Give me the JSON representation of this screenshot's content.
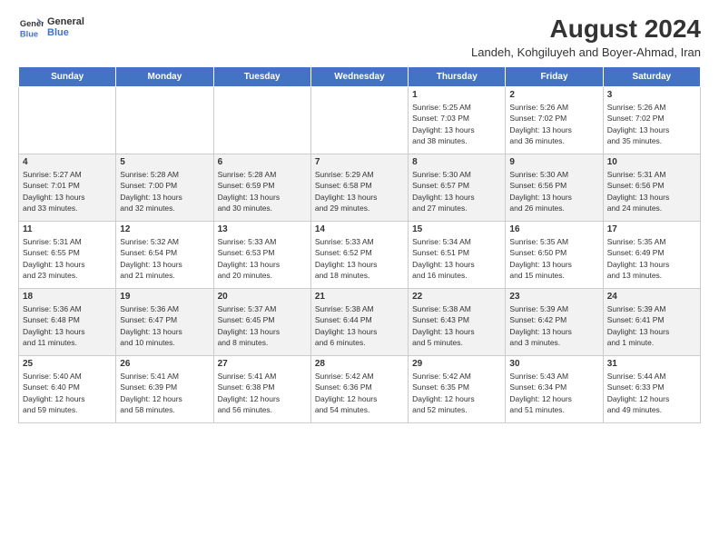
{
  "logo": {
    "line1": "General",
    "line2": "Blue"
  },
  "title": "August 2024",
  "subtitle": "Landeh, Kohgiluyeh and Boyer-Ahmad, Iran",
  "weekdays": [
    "Sunday",
    "Monday",
    "Tuesday",
    "Wednesday",
    "Thursday",
    "Friday",
    "Saturday"
  ],
  "weeks": [
    [
      {
        "day": "",
        "info": ""
      },
      {
        "day": "",
        "info": ""
      },
      {
        "day": "",
        "info": ""
      },
      {
        "day": "",
        "info": ""
      },
      {
        "day": "1",
        "info": "Sunrise: 5:25 AM\nSunset: 7:03 PM\nDaylight: 13 hours\nand 38 minutes."
      },
      {
        "day": "2",
        "info": "Sunrise: 5:26 AM\nSunset: 7:02 PM\nDaylight: 13 hours\nand 36 minutes."
      },
      {
        "day": "3",
        "info": "Sunrise: 5:26 AM\nSunset: 7:02 PM\nDaylight: 13 hours\nand 35 minutes."
      }
    ],
    [
      {
        "day": "4",
        "info": "Sunrise: 5:27 AM\nSunset: 7:01 PM\nDaylight: 13 hours\nand 33 minutes."
      },
      {
        "day": "5",
        "info": "Sunrise: 5:28 AM\nSunset: 7:00 PM\nDaylight: 13 hours\nand 32 minutes."
      },
      {
        "day": "6",
        "info": "Sunrise: 5:28 AM\nSunset: 6:59 PM\nDaylight: 13 hours\nand 30 minutes."
      },
      {
        "day": "7",
        "info": "Sunrise: 5:29 AM\nSunset: 6:58 PM\nDaylight: 13 hours\nand 29 minutes."
      },
      {
        "day": "8",
        "info": "Sunrise: 5:30 AM\nSunset: 6:57 PM\nDaylight: 13 hours\nand 27 minutes."
      },
      {
        "day": "9",
        "info": "Sunrise: 5:30 AM\nSunset: 6:56 PM\nDaylight: 13 hours\nand 26 minutes."
      },
      {
        "day": "10",
        "info": "Sunrise: 5:31 AM\nSunset: 6:56 PM\nDaylight: 13 hours\nand 24 minutes."
      }
    ],
    [
      {
        "day": "11",
        "info": "Sunrise: 5:31 AM\nSunset: 6:55 PM\nDaylight: 13 hours\nand 23 minutes."
      },
      {
        "day": "12",
        "info": "Sunrise: 5:32 AM\nSunset: 6:54 PM\nDaylight: 13 hours\nand 21 minutes."
      },
      {
        "day": "13",
        "info": "Sunrise: 5:33 AM\nSunset: 6:53 PM\nDaylight: 13 hours\nand 20 minutes."
      },
      {
        "day": "14",
        "info": "Sunrise: 5:33 AM\nSunset: 6:52 PM\nDaylight: 13 hours\nand 18 minutes."
      },
      {
        "day": "15",
        "info": "Sunrise: 5:34 AM\nSunset: 6:51 PM\nDaylight: 13 hours\nand 16 minutes."
      },
      {
        "day": "16",
        "info": "Sunrise: 5:35 AM\nSunset: 6:50 PM\nDaylight: 13 hours\nand 15 minutes."
      },
      {
        "day": "17",
        "info": "Sunrise: 5:35 AM\nSunset: 6:49 PM\nDaylight: 13 hours\nand 13 minutes."
      }
    ],
    [
      {
        "day": "18",
        "info": "Sunrise: 5:36 AM\nSunset: 6:48 PM\nDaylight: 13 hours\nand 11 minutes."
      },
      {
        "day": "19",
        "info": "Sunrise: 5:36 AM\nSunset: 6:47 PM\nDaylight: 13 hours\nand 10 minutes."
      },
      {
        "day": "20",
        "info": "Sunrise: 5:37 AM\nSunset: 6:45 PM\nDaylight: 13 hours\nand 8 minutes."
      },
      {
        "day": "21",
        "info": "Sunrise: 5:38 AM\nSunset: 6:44 PM\nDaylight: 13 hours\nand 6 minutes."
      },
      {
        "day": "22",
        "info": "Sunrise: 5:38 AM\nSunset: 6:43 PM\nDaylight: 13 hours\nand 5 minutes."
      },
      {
        "day": "23",
        "info": "Sunrise: 5:39 AM\nSunset: 6:42 PM\nDaylight: 13 hours\nand 3 minutes."
      },
      {
        "day": "24",
        "info": "Sunrise: 5:39 AM\nSunset: 6:41 PM\nDaylight: 13 hours\nand 1 minute."
      }
    ],
    [
      {
        "day": "25",
        "info": "Sunrise: 5:40 AM\nSunset: 6:40 PM\nDaylight: 12 hours\nand 59 minutes."
      },
      {
        "day": "26",
        "info": "Sunrise: 5:41 AM\nSunset: 6:39 PM\nDaylight: 12 hours\nand 58 minutes."
      },
      {
        "day": "27",
        "info": "Sunrise: 5:41 AM\nSunset: 6:38 PM\nDaylight: 12 hours\nand 56 minutes."
      },
      {
        "day": "28",
        "info": "Sunrise: 5:42 AM\nSunset: 6:36 PM\nDaylight: 12 hours\nand 54 minutes."
      },
      {
        "day": "29",
        "info": "Sunrise: 5:42 AM\nSunset: 6:35 PM\nDaylight: 12 hours\nand 52 minutes."
      },
      {
        "day": "30",
        "info": "Sunrise: 5:43 AM\nSunset: 6:34 PM\nDaylight: 12 hours\nand 51 minutes."
      },
      {
        "day": "31",
        "info": "Sunrise: 5:44 AM\nSunset: 6:33 PM\nDaylight: 12 hours\nand 49 minutes."
      }
    ]
  ]
}
